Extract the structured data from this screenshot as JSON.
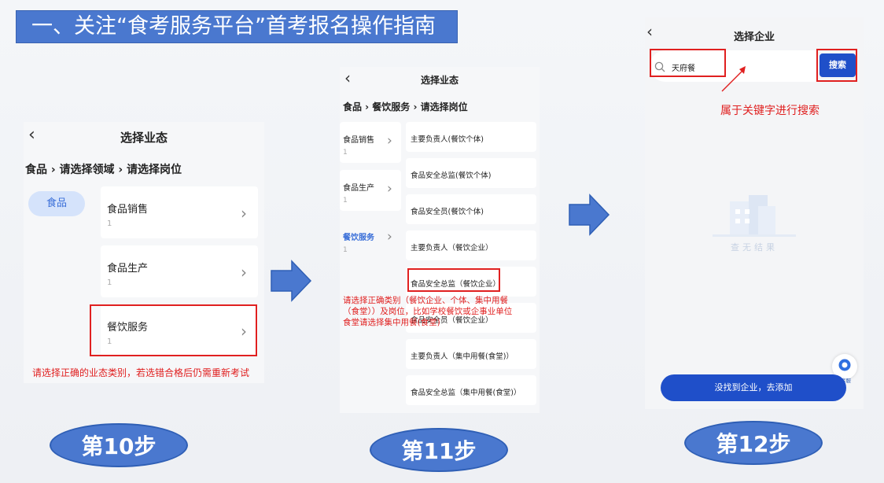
{
  "banner": {
    "title": "一、关注“食考服务平台”首考报名操作指南"
  },
  "screen10": {
    "nav_title": "选择业态",
    "breadcrumb": "食品 › 请选择领域 › 请选择岗位",
    "domain_tab": "食品",
    "items": [
      {
        "label": "食品销售",
        "count": "1"
      },
      {
        "label": "食品生产",
        "count": "1"
      },
      {
        "label": "餐饮服务",
        "count": "1"
      }
    ],
    "note": "请选择正确的业态类别，若选错合格后仍需重新考试"
  },
  "screen11": {
    "nav_title": "选择业态",
    "breadcrumb": "食品 › 餐饮服务 › 请选择岗位",
    "left_items": [
      {
        "label": "食品销售",
        "count": "1"
      },
      {
        "label": "食品生产",
        "count": "1"
      },
      {
        "label": "餐饮服务",
        "count": "1"
      }
    ],
    "positions": [
      "主要负责人(餐饮个体)",
      "食品安全总监(餐饮个体)",
      "食品安全员(餐饮个体)",
      "主要负责人（餐饮企业）",
      "食品安全总监（餐饮企业）",
      "食品安全员（餐饮企业）",
      "主要负责人（集中用餐(食堂)）",
      "食品安全总监（集中用餐(食堂)）"
    ],
    "note": "请选择正确类别（餐饮企业、个体、集中用餐（食堂））及岗位，比如学校餐饮或企事业单位食堂请选择集中用餐(食堂)"
  },
  "screen12": {
    "nav_title": "选择企业",
    "search_value": "天府餐",
    "search_button": "搜索",
    "note": "属于关键字进行搜索",
    "empty_text": "查无结果",
    "service_label": "在线客服",
    "add_button": "没找到企业，去添加"
  },
  "steps": [
    "第10步",
    "第11步",
    "第12步"
  ],
  "colors": {
    "accent": "#4a78cf",
    "brand_blue": "#1f4fc9",
    "warn_red": "#e02020"
  }
}
